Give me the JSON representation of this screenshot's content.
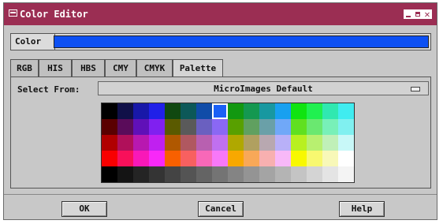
{
  "window": {
    "title": "Color Editor"
  },
  "color_field": {
    "label": "Color",
    "value_hex": "#0d50f3"
  },
  "tabs": [
    {
      "label": "RGB",
      "active": false
    },
    {
      "label": "HIS",
      "active": false
    },
    {
      "label": "HBS",
      "active": false
    },
    {
      "label": "CMY",
      "active": false
    },
    {
      "label": "CMYK",
      "active": false
    },
    {
      "label": "Palette",
      "active": true
    }
  ],
  "palette": {
    "select_from_label": "Select From:",
    "selected_palette": "MicroImages Default",
    "rows": [
      [
        "#000000",
        "#101048",
        "#1818a8",
        "#2020e8",
        "#104810",
        "#0c5858",
        "#104ca8",
        "#1a60f6",
        "#129810",
        "#149850",
        "#1898a0",
        "#18a0f0",
        "#10e410",
        "#20f050",
        "#30e8b0",
        "#40ecf0"
      ],
      [
        "#5a0000",
        "#5a0c5a",
        "#6010b8",
        "#8020f0",
        "#5a5a00",
        "#5a5a5a",
        "#6a60c0",
        "#8a68f4",
        "#58a000",
        "#60a060",
        "#6aa0a8",
        "#70a8f8",
        "#60e020",
        "#6ae870",
        "#78f0b8",
        "#80f0f0"
      ],
      [
        "#b00000",
        "#b0105a",
        "#b818b0",
        "#c020f0",
        "#b05800",
        "#b05860",
        "#b860b0",
        "#c070f0",
        "#b0a800",
        "#b0a060",
        "#b8a8b0",
        "#b8b0f8",
        "#b8f020",
        "#b8f070",
        "#c0f0b8",
        "#c8f8f8"
      ],
      [
        "#f80000",
        "#f8105a",
        "#f818b8",
        "#f828f8",
        "#f86000",
        "#f86060",
        "#f868b8",
        "#f878f8",
        "#f8a800",
        "#f8a858",
        "#f8b0b0",
        "#f8b8f8",
        "#f8f800",
        "#f8f870",
        "#f8f8b8",
        "#ffffff"
      ],
      [
        "#000000",
        "#141414",
        "#242424",
        "#343434",
        "#444444",
        "#545454",
        "#646464",
        "#747474",
        "#848484",
        "#949494",
        "#a4a4a4",
        "#b4b4b4",
        "#c4c4c4",
        "#d4d4d4",
        "#e4e4e4",
        "#f4f4f4"
      ]
    ],
    "selected_cell": "0,7"
  },
  "buttons": {
    "ok": "OK",
    "cancel": "Cancel",
    "help": "Help"
  },
  "colors": {
    "title_bar": "#9b2e53",
    "dialog_bg": "#c8c8c8"
  }
}
